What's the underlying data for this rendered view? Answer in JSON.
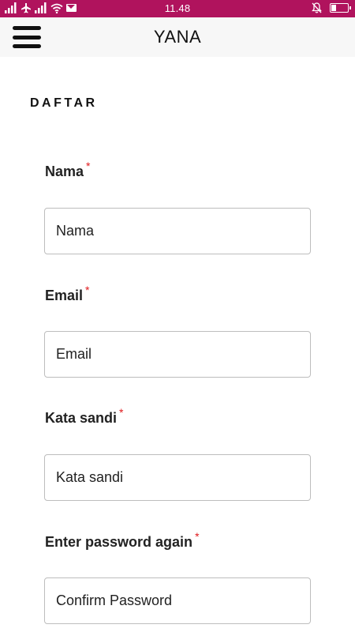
{
  "status_bar": {
    "time": "11.48",
    "color": "#b0135d"
  },
  "app_bar": {
    "title": "YANA",
    "menu_icon": "hamburger-menu-icon"
  },
  "form": {
    "heading": "DAFTAR",
    "required_marker": "*",
    "fields": [
      {
        "label": "Nama",
        "placeholder": "Nama",
        "value": ""
      },
      {
        "label": "Email",
        "placeholder": "Email",
        "value": ""
      },
      {
        "label": "Kata sandi",
        "placeholder": "Kata sandi",
        "value": ""
      },
      {
        "label": "Enter password again",
        "placeholder": "Confirm Password",
        "value": ""
      }
    ]
  },
  "colors": {
    "accent": "#b0135d",
    "required": "#e0191c",
    "input_border": "#bdbdbd"
  }
}
